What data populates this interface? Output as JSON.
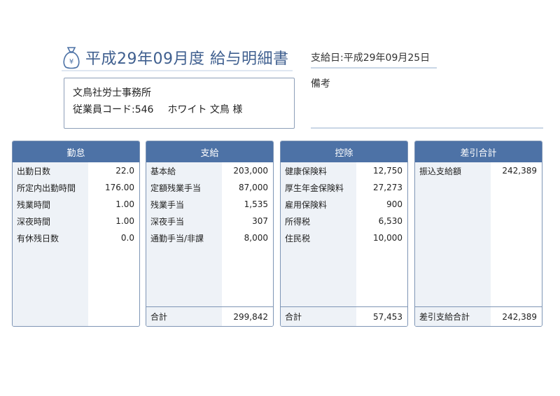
{
  "header": {
    "title": "平成29年09月度 給与明細書",
    "pay_date": "支給日:平成29年09月25日",
    "remarks_label": "備考"
  },
  "company": {
    "name": "文鳥社労士事務所",
    "employee_code": "従業員コード:546",
    "employee_name": "ホワイト 文鳥 様"
  },
  "panels": {
    "attendance": {
      "title": "勤怠",
      "rows": [
        {
          "label": "出勤日数",
          "value": "22.0"
        },
        {
          "label": "所定内出勤時間",
          "value": "176.00"
        },
        {
          "label": "残業時間",
          "value": "1.00"
        },
        {
          "label": "深夜時間",
          "value": "1.00"
        },
        {
          "label": "有休残日数",
          "value": "0.0"
        }
      ]
    },
    "payment": {
      "title": "支給",
      "rows": [
        {
          "label": "基本給",
          "value": "203,000"
        },
        {
          "label": "定額残業手当",
          "value": "87,000"
        },
        {
          "label": "残業手当",
          "value": "1,535"
        },
        {
          "label": "深夜手当",
          "value": "307"
        },
        {
          "label": "通勤手当/非課",
          "value": "8,000"
        }
      ],
      "total_label": "合計",
      "total_value": "299,842"
    },
    "deduction": {
      "title": "控除",
      "rows": [
        {
          "label": "健康保険料",
          "value": "12,750"
        },
        {
          "label": "厚生年金保険料",
          "value": "27,273"
        },
        {
          "label": "雇用保険料",
          "value": "900"
        },
        {
          "label": "所得税",
          "value": "6,530"
        },
        {
          "label": "住民税",
          "value": "10,000"
        }
      ],
      "total_label": "合計",
      "total_value": "57,453"
    },
    "net": {
      "title": "差引合計",
      "rows": [
        {
          "label": "振込支給額",
          "value": "242,389"
        }
      ],
      "total_label": "差引支給合計",
      "total_value": "242,389"
    }
  },
  "colors": {
    "header_bg": "#4d72a6",
    "title_text": "#3f5f8f",
    "label_bg": "#eef2f7",
    "border": "#7e95b5"
  },
  "icons": {
    "title_icon": "money-bag-icon"
  }
}
